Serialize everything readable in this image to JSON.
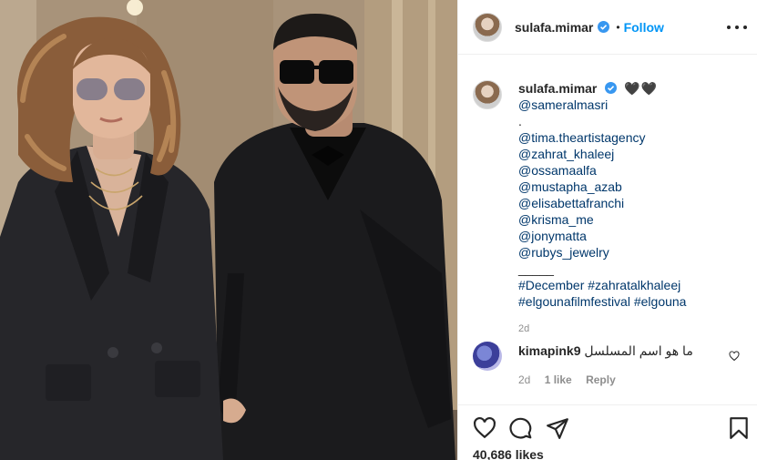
{
  "post": {
    "username": "sulafa.mimar",
    "dot": "•",
    "follow_label": "Follow"
  },
  "caption": {
    "username": "sulafa.mimar",
    "hearts": "🖤🖤",
    "first_mention": "@sameralmasri",
    "line_dot": ".",
    "mentions": [
      "@tima.theartistagency",
      "@zahrat_khaleej",
      "@ossamaalfa",
      "@mustapha_azab",
      "@elisabettafranchi",
      "@krisma_me",
      "@jonymatta",
      "@rubys_jewelry"
    ],
    "separator": "_____",
    "hashtags_line1": [
      "#December",
      "#zahratalkhaleej"
    ],
    "hashtags_line2": [
      "#elgounafilmfestival",
      "#elgouna"
    ],
    "time": "2d"
  },
  "comment": {
    "username": "kimapink9",
    "text": "ما هو اسم المسلسل",
    "time": "2d",
    "likes": "1 like",
    "reply_label": "Reply"
  },
  "footer": {
    "likes": "40,686 likes"
  },
  "icons": {
    "verified": "verified-badge-icon",
    "like": "heart-icon",
    "comment": "comment-icon",
    "share": "share-icon",
    "save": "bookmark-icon",
    "more": "more-options-icon"
  },
  "colors": {
    "accent": "#0095f6",
    "link": "#00376b",
    "muted": "#8e8e8e"
  }
}
